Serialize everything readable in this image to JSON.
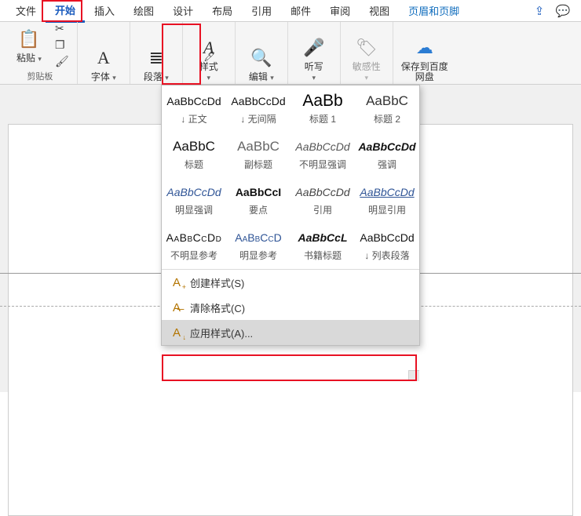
{
  "tabs": {
    "file": "文件",
    "home": "开始",
    "insert": "插入",
    "draw": "绘图",
    "design": "设计",
    "layout": "布局",
    "references": "引用",
    "mail": "邮件",
    "review": "审阅",
    "view": "视图",
    "header_footer": "页眉和页脚"
  },
  "ribbon": {
    "paste": "粘贴",
    "clipboard_group": "剪贴板",
    "font": "字体",
    "paragraph": "段落",
    "styles": "样式",
    "editing": "编辑",
    "dictate": "听写",
    "sensitivity": "敏感性",
    "save_baidu": "保存到百度网盘"
  },
  "styles_gallery": [
    {
      "sample": "AaBbCcDd",
      "cls": "",
      "name": "↓ 正文"
    },
    {
      "sample": "AaBbCcDd",
      "cls": "",
      "name": "↓ 无间隔"
    },
    {
      "sample": "AaBb",
      "cls": "samp-h1",
      "name": "标题 1"
    },
    {
      "sample": "AaBbC",
      "cls": "samp-h2",
      "name": "标题 2"
    },
    {
      "sample": "AaBbC",
      "cls": "samp-title",
      "name": "标题"
    },
    {
      "sample": "AaBbC",
      "cls": "samp-sub",
      "name": "副标题"
    },
    {
      "sample": "AaBbCcDd",
      "cls": "samp-italic",
      "name": "不明显强调"
    },
    {
      "sample": "AaBbCcDd",
      "cls": "samp-strong-em",
      "name": "强调"
    },
    {
      "sample": "AaBbCcDd",
      "cls": "samp-link-italic",
      "name": "明显强调"
    },
    {
      "sample": "AaBbCcI",
      "cls": "samp-bold",
      "name": "要点"
    },
    {
      "sample": "AaBbCcDd",
      "cls": "samp-quote",
      "name": "引用"
    },
    {
      "sample": "AaBbCcDd",
      "cls": "samp-intquote",
      "name": "明显引用"
    },
    {
      "sample": "AaBbCcDd",
      "cls": "samp-smallcaps",
      "name": "不明显参考"
    },
    {
      "sample": "AaBbCcD",
      "cls": "samp-bluecaps",
      "name": "明显参考"
    },
    {
      "sample": "AaBbCcL",
      "cls": "samp-book",
      "name": "书籍标题"
    },
    {
      "sample": "AaBbCcDd",
      "cls": "",
      "name": "↓ 列表段落"
    }
  ],
  "panel": {
    "create_style": "创建样式(S)",
    "clear_format": "清除格式(C)",
    "apply_styles": "应用样式(A)..."
  }
}
